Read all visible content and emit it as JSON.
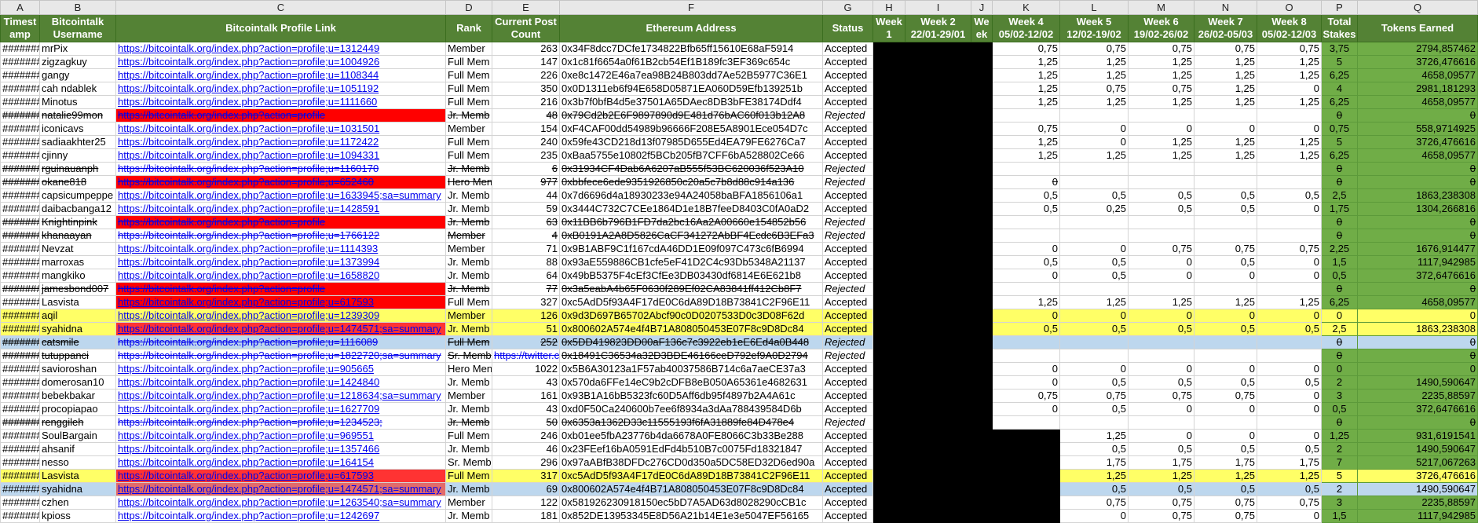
{
  "columns": [
    "A",
    "B",
    "C",
    "D",
    "E",
    "F",
    "G",
    "H",
    "I",
    "J",
    "K",
    "L",
    "M",
    "N",
    "O",
    "P",
    "Q"
  ],
  "headers": {
    "A": "Timest amp",
    "B": "Bitcointalk Username",
    "C": "Bitcointalk Profile Link",
    "D": "Rank",
    "E": "Current Post Count",
    "F": "Ethereum Address",
    "G": "Status",
    "H": "Week 1",
    "I": "Week 2 22/01-29/01",
    "J": "We ek",
    "K": "Week 4 05/02-12/02",
    "L": "Week 5 12/02-19/02",
    "M": "Week 6 19/02-26/02",
    "N": "Week 7 26/02-05/03",
    "O": "Week 8 05/02-12/03",
    "P": "Total Stakes",
    "Q": "Tokens Earned"
  },
  "colors": {
    "header_green": "#548235",
    "total_green": "#70ad47",
    "reject_red": "#ff0000",
    "highlight": "#ffff66",
    "selected": "#bdd7ee"
  },
  "rows": [
    {
      "ts": "#######",
      "user": "mrPix",
      "link": "https://bitcointalk.org/index.php?action=profile;u=1312449",
      "rank": "Member",
      "posts": "263",
      "eth": "0x34F8dcc7DCfe1734822Bfb65ff15610E68aF5914",
      "status": "Accepted",
      "k": "0,75",
      "l": "0,75",
      "m": "0,75",
      "n": "0,75",
      "o": "0,75",
      "p": "3,75",
      "q": "2794,857462"
    },
    {
      "ts": "#######",
      "user": "zigzagkuy",
      "link": "https://bitcointalk.org/index.php?action=profile;u=1004926",
      "rank": "Full Mem",
      "posts": "147",
      "eth": "0x1c81f6654a0f61B2cb54Ef1B189fc3EF369c654c",
      "status": "Accepted",
      "k": "1,25",
      "l": "1,25",
      "m": "1,25",
      "n": "1,25",
      "o": "1,25",
      "p": "5",
      "q": "3726,476616"
    },
    {
      "ts": "#######",
      "user": "gangy",
      "link": "https://bitcointalk.org/index.php?action=profile;u=1108344",
      "rank": "Full Mem",
      "posts": "226",
      "eth": "0xe8c1472E46a7ea98B24B803dd7Ae52B5977C36E1",
      "status": "Accepted",
      "k": "1,25",
      "l": "1,25",
      "m": "1,25",
      "n": "1,25",
      "o": "1,25",
      "p": "6,25",
      "q": "4658,09577"
    },
    {
      "ts": "#######",
      "user": "cah ndablek",
      "link": "https://bitcointalk.org/index.php?action=profile;u=1051192",
      "rank": "Full Mem",
      "posts": "350",
      "eth": "0x0D1311eb6f94E658D05871EA060D59Efb139251b",
      "status": "Accepted",
      "k": "1,25",
      "l": "0,75",
      "m": "0,75",
      "n": "1,25",
      "o": "0",
      "p": "4",
      "q": "2981,181293"
    },
    {
      "ts": "#######",
      "user": "Minotus",
      "link": "https://bitcointalk.org/index.php?action=profile;u=1111660",
      "rank": "Full Mem",
      "posts": "216",
      "eth": "0x3b7f0bfB4d5e37501A65DAec8DB3bFE38174Ddf4",
      "status": "Accepted",
      "k": "1,25",
      "l": "1,25",
      "m": "1,25",
      "n": "1,25",
      "o": "1,25",
      "p": "6,25",
      "q": "4658,09577"
    },
    {
      "ts": "#######",
      "user": "natalie99mon",
      "link": "https://bitcointalk.org/index.php?action=profile",
      "rank": "Jr. Memb",
      "posts": "48",
      "eth": "0x79Cd2b2E6F9897890d9E481d76bAC60f013b12A8",
      "status": "Rejected",
      "k": "",
      "l": "",
      "m": "",
      "n": "",
      "o": "",
      "p": "0",
      "q": "0",
      "rej": true,
      "red": true
    },
    {
      "ts": "#######",
      "user": "iconicavs",
      "link": "https://bitcointalk.org/index.php?action=profile;u=1031501",
      "rank": "Member",
      "posts": "154",
      "eth": "0xF4CAF00dd54989b96666F208E5A8901Ece054D7c",
      "status": "Accepted",
      "k": "0,75",
      "l": "0",
      "m": "0",
      "n": "0",
      "o": "0",
      "p": "0,75",
      "q": "558,9714925"
    },
    {
      "ts": "#######",
      "user": "sadiaakhter25",
      "link": "https://bitcointalk.org/index.php?action=profile;u=1172422",
      "rank": "Full Mem",
      "posts": "240",
      "eth": "0x59fe43CD218d13f07985D655Ed4EA79FE6276Ca7",
      "status": "Accepted",
      "k": "1,25",
      "l": "0",
      "m": "1,25",
      "n": "1,25",
      "o": "1,25",
      "p": "5",
      "q": "3726,476616"
    },
    {
      "ts": "#######",
      "user": "cjinny",
      "link": "https://bitcointalk.org/index.php?action=profile;u=1094331",
      "rank": "Full Mem",
      "posts": "235",
      "eth": "0xBaa5755e10802f5BCb205fB7CFF6bA528802Ce66",
      "status": "Accepted",
      "k": "1,25",
      "l": "1,25",
      "m": "1,25",
      "n": "1,25",
      "o": "1,25",
      "p": "6,25",
      "q": "4658,09577"
    },
    {
      "ts": "#######",
      "user": "rguinauanph",
      "link": "https://bitcointalk.org/index.php?action=profile;u=1160170",
      "rank": "Jr. Memb",
      "posts": "6",
      "eth": "0x31934CF4Dab6A6207aB555f53BC620036f523A10",
      "status": "Rejected",
      "k": "",
      "l": "",
      "m": "",
      "n": "",
      "o": "",
      "p": "0",
      "q": "0",
      "rej": true
    },
    {
      "ts": "#######",
      "user": "okane818",
      "link": "https://bitcointalk.org/index.php?action=profile;u=652460",
      "rank": "Hero Men",
      "posts": "977",
      "eth": "0xbbfece6ede9351926850c20a5c7b8d88c914a136",
      "status": "Rejected",
      "k": "0",
      "l": "",
      "m": "",
      "n": "",
      "o": "",
      "p": "0",
      "q": "0",
      "rej": true,
      "red": true
    },
    {
      "ts": "#######",
      "user": "capsicumpeppe",
      "link": "https://bitcointalk.org/index.php?action=profile;u=1633945;sa=summary",
      "rank": "Jr. Memb",
      "posts": "44",
      "eth": "0x7d6696d4a18930233e94A24058baBFA1856106a1",
      "status": "Accepted",
      "k": "0,5",
      "l": "0,5",
      "m": "0,5",
      "n": "0,5",
      "o": "0,5",
      "p": "2,5",
      "q": "1863,238308"
    },
    {
      "ts": "#######",
      "user": "daibacbanga12",
      "link": "https://bitcointalk.org/index.php?action=profile;u=1428591",
      "rank": "Jr. Memb",
      "posts": "59",
      "eth": "0x3444C732C7CEe1864D1e18B7feeD8403C0fA0aD2",
      "status": "Accepted",
      "k": "0,5",
      "l": "0,25",
      "m": "0,5",
      "n": "0,5",
      "o": "0",
      "p": "1,75",
      "q": "1304,266816"
    },
    {
      "ts": "#######",
      "user": "Knightinpink",
      "link": "https://bitcointalk.org/index.php?action=profile",
      "rank": "Jr. Memb",
      "posts": "63",
      "eth": "0x11BB6b796B1FD7da2bc16Aa2A00660e154852b56",
      "status": "Rejected",
      "k": "",
      "l": "",
      "m": "",
      "n": "",
      "o": "",
      "p": "0",
      "q": "0",
      "rej": true,
      "red": true
    },
    {
      "ts": "#######",
      "user": "khanaayan",
      "link": "https://bitcointalk.org/index.php?action=profile;u=1766122",
      "rank": "Member",
      "posts": "4",
      "eth": "0xB0191A2A8D5826CaCF341272AbBF4Ecdc6B3EFa3",
      "status": "Rejected",
      "k": "",
      "l": "",
      "m": "",
      "n": "",
      "o": "",
      "p": "0",
      "q": "0",
      "rej": true
    },
    {
      "ts": "#######",
      "user": "Nevzat",
      "link": "https://bitcointalk.org/index.php?action=profile;u=1114393",
      "rank": "Member",
      "posts": "71",
      "eth": "0x9B1ABF9C1f167cdA46DD1E09f097C473c6fB6994",
      "status": "Accepted",
      "k": "0",
      "l": "0",
      "m": "0,75",
      "n": "0,75",
      "o": "0,75",
      "p": "2,25",
      "q": "1676,914477"
    },
    {
      "ts": "#######",
      "user": "marroxas",
      "link": "https://bitcointalk.org/index.php?action=profile;u=1373994",
      "rank": "Jr. Memb",
      "posts": "88",
      "eth": "0x93aE559886CB1cfe5eF41D2C4c93Db5348A21137",
      "status": "Accepted",
      "k": "0,5",
      "l": "0,5",
      "m": "0",
      "n": "0,5",
      "o": "0",
      "p": "1,5",
      "q": "1117,942985"
    },
    {
      "ts": "#######",
      "user": "mangkiko",
      "link": "https://bitcointalk.org/index.php?action=profile;u=1658820",
      "rank": "Jr. Memb",
      "posts": "64",
      "eth": "0x49bB5375F4cEf3CfEe3DB03430df6814E6E621b8",
      "status": "Accepted",
      "k": "0",
      "l": "0,5",
      "m": "0",
      "n": "0",
      "o": "0",
      "p": "0,5",
      "q": "372,6476616"
    },
    {
      "ts": "#######",
      "user": "jamesbond007",
      "link": "https://bitcointalk.org/index.php?action=profile",
      "rank": "Jr. Memb",
      "posts": "77",
      "eth": "0x3a5eabA4b65F0630f289Ef02CA83841ff412Cb8F7",
      "status": "Rejected",
      "k": "",
      "l": "",
      "m": "",
      "n": "",
      "o": "",
      "p": "0",
      "q": "0",
      "rej": true,
      "red": true
    },
    {
      "ts": "#######",
      "user": "Lasvista",
      "link": "https://bitcointalk.org/index.php?action=profile;u=617593",
      "rank": "Full Mem",
      "posts": "327",
      "eth": "0xc5AdD5f93A4F17dE0C6dA89D18B73841C2F96E11",
      "status": "Accepted",
      "k": "1,25",
      "l": "1,25",
      "m": "1,25",
      "n": "1,25",
      "o": "1,25",
      "p": "6,25",
      "q": "4658,09577",
      "red": true
    },
    {
      "ts": "#######",
      "user": "aqil",
      "link": "https://bitcointalk.org/index.php?action=profile;u=1239309",
      "rank": "Member",
      "posts": "126",
      "eth": "0x9d3D697B65702Abcf90c0D0207533D0c3D08F62d",
      "status": "Accepted",
      "k": "0",
      "l": "0",
      "m": "0",
      "n": "0",
      "o": "0",
      "p": "0",
      "q": "0",
      "hl": true
    },
    {
      "ts": "#######",
      "user": "syahidna",
      "link": "https://bitcointalk.org/index.php?action=profile;u=1474571;sa=summary",
      "rank": "Jr. Memb",
      "posts": "51",
      "eth": "0x800602A574e4f4B71A808050453E07F8c9D8Dc84",
      "status": "Accepted",
      "k": "0,5",
      "l": "0,5",
      "m": "0,5",
      "n": "0,5",
      "o": "0,5",
      "p": "2,5",
      "q": "1863,238308",
      "hl": true,
      "red": true
    },
    {
      "ts": "#######",
      "user": "catsmile",
      "link": "https://bitcointalk.org/index.php?action=profile;u=1116089",
      "rank": "Full Mem",
      "posts": "252",
      "eth": "0x5DD419823DD00aF136c7c3922eb1eE6Ed4a0B448",
      "status": "Rejected",
      "k": "",
      "l": "",
      "m": "",
      "n": "",
      "o": "",
      "p": "0",
      "q": "0",
      "rej": true,
      "sel": true
    },
    {
      "ts": "#######",
      "user": "tutuppanci",
      "link": "https://bitcointalk.org/index.php?action=profile;u=1822720;sa=summary",
      "rank": "Sr. Memb",
      "posts": "https://twitter.c",
      "eth": "0x18491C36534a32D3BDE46166ceD792ef9A0D2794",
      "status": "Rejected",
      "k": "",
      "l": "",
      "m": "",
      "n": "",
      "o": "",
      "p": "0",
      "q": "0",
      "rej": true,
      "postlink": true
    },
    {
      "ts": "#######",
      "user": "savioroshan",
      "link": "https://bitcointalk.org/index.php?action=profile;u=905665",
      "rank": "Hero Men",
      "posts": "1022",
      "eth": "0x5B6A30123a1F57ab40037586B714c6a7aeCE37a3",
      "status": "Accepted",
      "k": "0",
      "l": "0",
      "m": "0",
      "n": "0",
      "o": "0",
      "p": "0",
      "q": "0"
    },
    {
      "ts": "#######",
      "user": "domerosan10",
      "link": "https://bitcointalk.org/index.php?action=profile;u=1424840",
      "rank": "Jr. Memb",
      "posts": "43",
      "eth": "0x570da6FFe14eC9b2cDFB8eB050A65361e4682631",
      "status": "Accepted",
      "k": "0",
      "l": "0,5",
      "m": "0,5",
      "n": "0,5",
      "o": "0,5",
      "p": "2",
      "q": "1490,590647"
    },
    {
      "ts": "#######",
      "user": "bebekbakar",
      "link": "https://bitcointalk.org/index.php?action=profile;u=1218634;sa=summary",
      "rank": "Member",
      "posts": "161",
      "eth": "0x93B1A16bB5323fc60D5Aff6db95f4897b2A4A61c",
      "status": "Accepted",
      "k": "0,75",
      "l": "0,75",
      "m": "0,75",
      "n": "0,75",
      "o": "0",
      "p": "3",
      "q": "2235,88597"
    },
    {
      "ts": "#######",
      "user": "procopiapao",
      "link": "https://bitcointalk.org/index.php?action=profile;u=1627709",
      "rank": "Jr. Memb",
      "posts": "43",
      "eth": "0xd0F50Ca240600b7ee6f8934a3dAa788439584D6b",
      "status": "Accepted",
      "k": "0",
      "l": "0,5",
      "m": "0",
      "n": "0",
      "o": "0",
      "p": "0,5",
      "q": "372,6476616"
    },
    {
      "ts": "#######",
      "user": "renggileh",
      "link": "https://bitcointalk.org/index.php?action=profile;u=1234523;",
      "rank": "Jr. Memb",
      "posts": "50",
      "eth": "0x6353a1362D33c11555193f6fA31889fe84D478e4",
      "status": "Rejected",
      "k": "",
      "l": "",
      "m": "",
      "n": "",
      "o": "",
      "p": "0",
      "q": "0",
      "rej": true
    },
    {
      "ts": "#######",
      "user": "SoulBargain",
      "link": "https://bitcointalk.org/index.php?action=profile;u=969551",
      "rank": "Full Mem",
      "posts": "246",
      "eth": "0xb01ee5fbA23776b4da6678A0FE8066C3b33Be288",
      "status": "Accepted",
      "k": "",
      "l": "1,25",
      "m": "0",
      "n": "0",
      "o": "0",
      "p": "1,25",
      "q": "931,6191541",
      "kblack": true
    },
    {
      "ts": "#######",
      "user": "ahsanif",
      "link": "https://bitcointalk.org/index.php?action=profile;u=1357466",
      "rank": "Jr. Memb",
      "posts": "46",
      "eth": "0x23FEef16bA0591EdFd4b510B7c0075Fd18321847",
      "status": "Accepted",
      "k": "",
      "l": "0,5",
      "m": "0,5",
      "n": "0,5",
      "o": "0,5",
      "p": "2",
      "q": "1490,590647",
      "kblack": true
    },
    {
      "ts": "#######",
      "user": "nesso",
      "link": "https://bitcointalk.org/index.php?action=profile;u=164154",
      "rank": "Sr. Memb",
      "posts": "296",
      "eth": "0x97aABfB38DFDc276CD0d350a5DC58ED32D6ed90a",
      "status": "Accepted",
      "k": "",
      "l": "1,75",
      "m": "1,75",
      "n": "1,75",
      "o": "1,75",
      "p": "7",
      "q": "5217,067263",
      "kblack": true
    },
    {
      "ts": "#######",
      "user": "Lasvista",
      "link": "https://bitcointalk.org/index.php?action=profile;u=617593",
      "rank": "Full Mem",
      "posts": "317",
      "eth": "0xc5AdD5f93A4F17dE0C6dA89D18B73841C2F96E11",
      "status": "Accepted",
      "k": "",
      "l": "1,25",
      "m": "1,25",
      "n": "1,25",
      "o": "1,25",
      "p": "5",
      "q": "3726,476616",
      "kblack": true,
      "red": true,
      "hl": true
    },
    {
      "ts": "#######",
      "user": "syahidna",
      "link": "https://bitcointalk.org/index.php?action=profile;u=1474571;sa=summary",
      "rank": "Jr. Memb",
      "posts": "69",
      "eth": "0x800602A574e4f4B71A808050453E07F8c9D8Dc84",
      "status": "Accepted",
      "k": "",
      "l": "0,5",
      "m": "0,5",
      "n": "0,5",
      "o": "0,5",
      "p": "2",
      "q": "1490,590647",
      "kblack": true,
      "red": true,
      "sel": true
    },
    {
      "ts": "#######",
      "user": "czhen",
      "link": "https://bitcointalk.org/index.php?action=profile;u=1263540;sa=summary",
      "rank": "Member",
      "posts": "122",
      "eth": "0x581926230918150ec5bD7A5AD63d8028290cCB1c",
      "status": "Accepted",
      "k": "",
      "l": "0,75",
      "m": "0,75",
      "n": "0,75",
      "o": "0,75",
      "p": "3",
      "q": "2235,88597",
      "kblack": true
    },
    {
      "ts": "#######",
      "user": "kpioss",
      "link": "https://bitcointalk.org/index.php?action=profile;u=1242697",
      "rank": "Jr. Memb",
      "posts": "181",
      "eth": "0x852DE13953345E8D56A21b14E1e3e5047EF56165",
      "status": "Accepted",
      "k": "",
      "l": "0",
      "m": "0,75",
      "n": "0,75",
      "o": "0",
      "p": "1,5",
      "q": "1117,942985",
      "kblack": true
    }
  ]
}
